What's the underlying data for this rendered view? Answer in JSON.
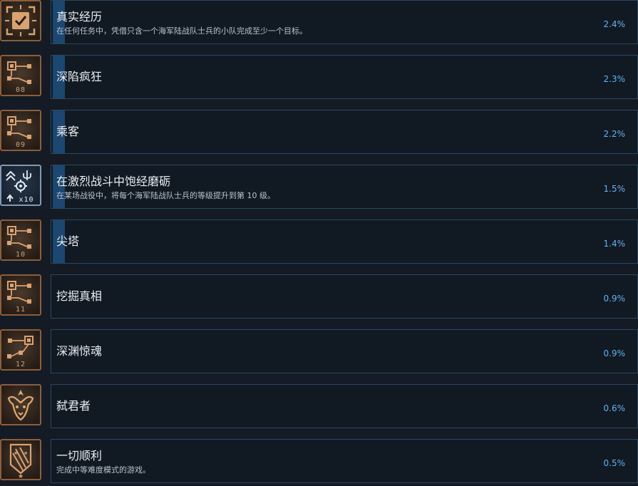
{
  "achievements": [
    {
      "title": "真实经历",
      "description": "在任何任务中，凭借只含一个海军陆战队士兵的小队完成至少一个目标。",
      "percent": "2.4%",
      "icon": "checkbox-target-icon",
      "number": "",
      "show_bar": true
    },
    {
      "title": "深陷疯狂",
      "description": "",
      "percent": "2.3%",
      "icon": "network-map-icon",
      "number": "08",
      "show_bar": true
    },
    {
      "title": "乘客",
      "description": "",
      "percent": "2.2%",
      "icon": "network-map-icon",
      "number": "09",
      "show_bar": true
    },
    {
      "title": "在激烈战斗中饱经磨砺",
      "description": "在某场战役中，将每个海军陆战队士兵的等级提升到第 10 级。",
      "percent": "1.5%",
      "icon": "rank-up-icon",
      "number": "x10",
      "show_bar": true
    },
    {
      "title": "尖塔",
      "description": "",
      "percent": "1.4%",
      "icon": "network-map-icon",
      "number": "10",
      "show_bar": true
    },
    {
      "title": "挖掘真相",
      "description": "",
      "percent": "0.9%",
      "icon": "network-map-icon",
      "number": "11",
      "show_bar": false
    },
    {
      "title": "深渊惊魂",
      "description": "",
      "percent": "0.9%",
      "icon": "network-map-icon",
      "number": "12",
      "show_bar": false
    },
    {
      "title": "弑君者",
      "description": "",
      "percent": "0.6%",
      "icon": "beast-crest-icon",
      "number": "",
      "show_bar": false
    },
    {
      "title": "一切顺利",
      "description": "完成中等难度模式的游戏。",
      "percent": "0.5%",
      "icon": "shield-stars-icon",
      "number": "",
      "show_bar": false
    }
  ],
  "colors": {
    "accent": "#61b4f0",
    "icon_border": "#8c5e3c",
    "card_border": "#2a4860",
    "bar": "#1b4770"
  }
}
